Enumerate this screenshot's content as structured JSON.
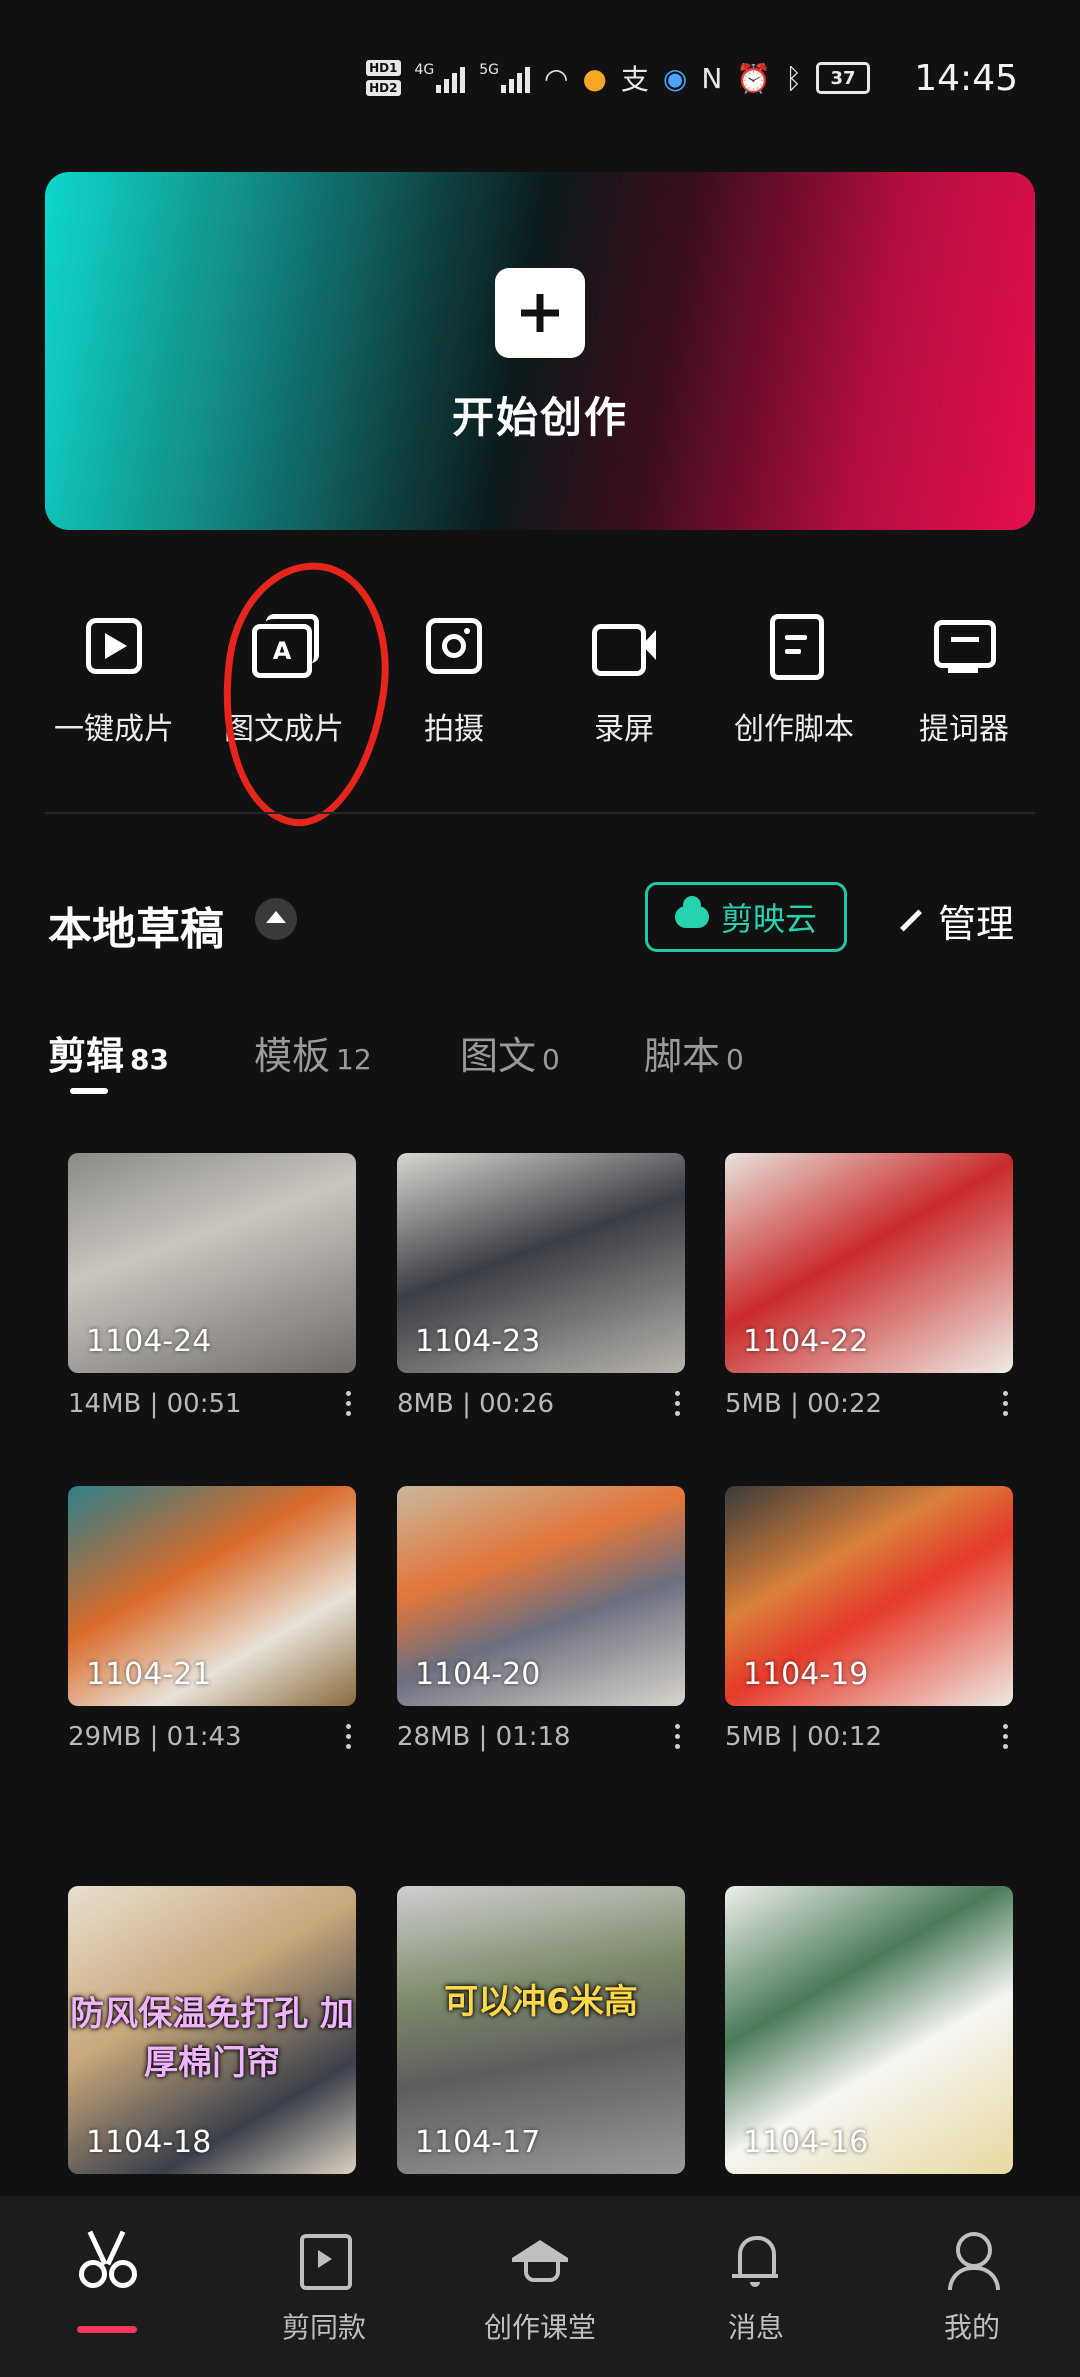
{
  "status": {
    "time": "14:45",
    "battery": "37",
    "network_labels": [
      "4G",
      "5G"
    ]
  },
  "banner": {
    "title": "开始创作",
    "icon": "plus-icon"
  },
  "tools": [
    {
      "label": "一键成片",
      "icon": "play-icon"
    },
    {
      "label": "图文成片",
      "icon": "text-to-video-icon"
    },
    {
      "label": "拍摄",
      "icon": "camera-icon"
    },
    {
      "label": "录屏",
      "icon": "screen-record-icon"
    },
    {
      "label": "创作脚本",
      "icon": "script-icon"
    },
    {
      "label": "提词器",
      "icon": "teleprompter-icon"
    }
  ],
  "drafts": {
    "title": "本地草稿",
    "cloud_label": "剪映云",
    "manage_label": "管理"
  },
  "tabs": [
    {
      "label": "剪辑",
      "count": "83",
      "active": true
    },
    {
      "label": "模板",
      "count": "12"
    },
    {
      "label": "图文",
      "count": "0"
    },
    {
      "label": "脚本",
      "count": "0"
    }
  ],
  "items": [
    {
      "name": "1104-24",
      "meta": "14MB | 00:51",
      "caption": ""
    },
    {
      "name": "1104-23",
      "meta": "8MB | 00:26",
      "caption": ""
    },
    {
      "name": "1104-22",
      "meta": "5MB | 00:22",
      "caption": ""
    },
    {
      "name": "1104-21",
      "meta": "29MB | 01:43",
      "caption": ""
    },
    {
      "name": "1104-20",
      "meta": "28MB | 01:18",
      "caption": ""
    },
    {
      "name": "1104-19",
      "meta": "5MB | 00:12",
      "caption": ""
    },
    {
      "name": "1104-18",
      "meta": "",
      "caption": "防风保温免打孔 加厚棉门帘"
    },
    {
      "name": "1104-17",
      "meta": "",
      "caption": "可以冲6米高"
    },
    {
      "name": "1104-16",
      "meta": "",
      "caption": ""
    }
  ],
  "nav": [
    {
      "label": "",
      "icon": "scissors-icon",
      "active": true
    },
    {
      "label": "剪同款",
      "icon": "template-icon"
    },
    {
      "label": "创作课堂",
      "icon": "graduation-cap-icon"
    },
    {
      "label": "消息",
      "icon": "bell-icon"
    },
    {
      "label": "我的",
      "icon": "profile-icon"
    }
  ],
  "colors": {
    "background": "#111111",
    "accent_teal": "#27d2b0",
    "accent_red": "#f2385d",
    "annotation_red": "#e8251a"
  }
}
